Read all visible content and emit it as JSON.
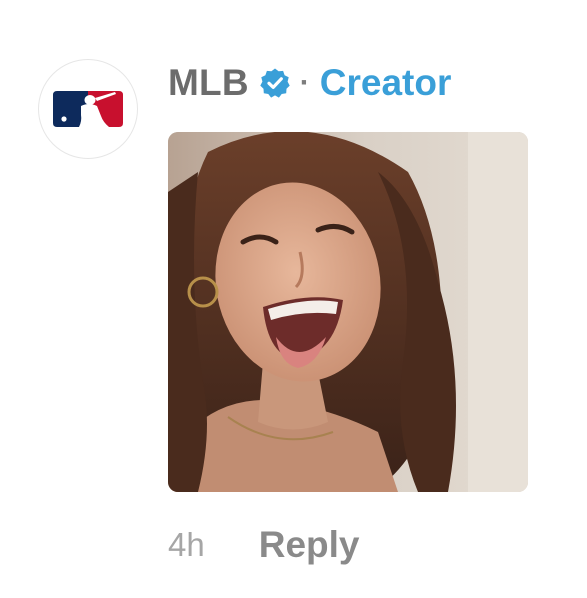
{
  "comment": {
    "author": {
      "name": "MLB",
      "verified": true,
      "avatar_icon": "mlb-logo-icon",
      "separator": "·",
      "role_label": "Creator"
    },
    "attachment": {
      "type": "photo",
      "description_icon": "photo-attachment"
    },
    "time_ago": "4h",
    "reply_label": "Reply"
  },
  "colors": {
    "username": "#6c6c6c",
    "creator": "#3a9fd8",
    "verified_badge": "#3a9fd8",
    "timestamp": "#a6a6a6",
    "reply": "#8a8a8a",
    "mlb_blue": "#0d2a5c",
    "mlb_red": "#c8102e"
  }
}
